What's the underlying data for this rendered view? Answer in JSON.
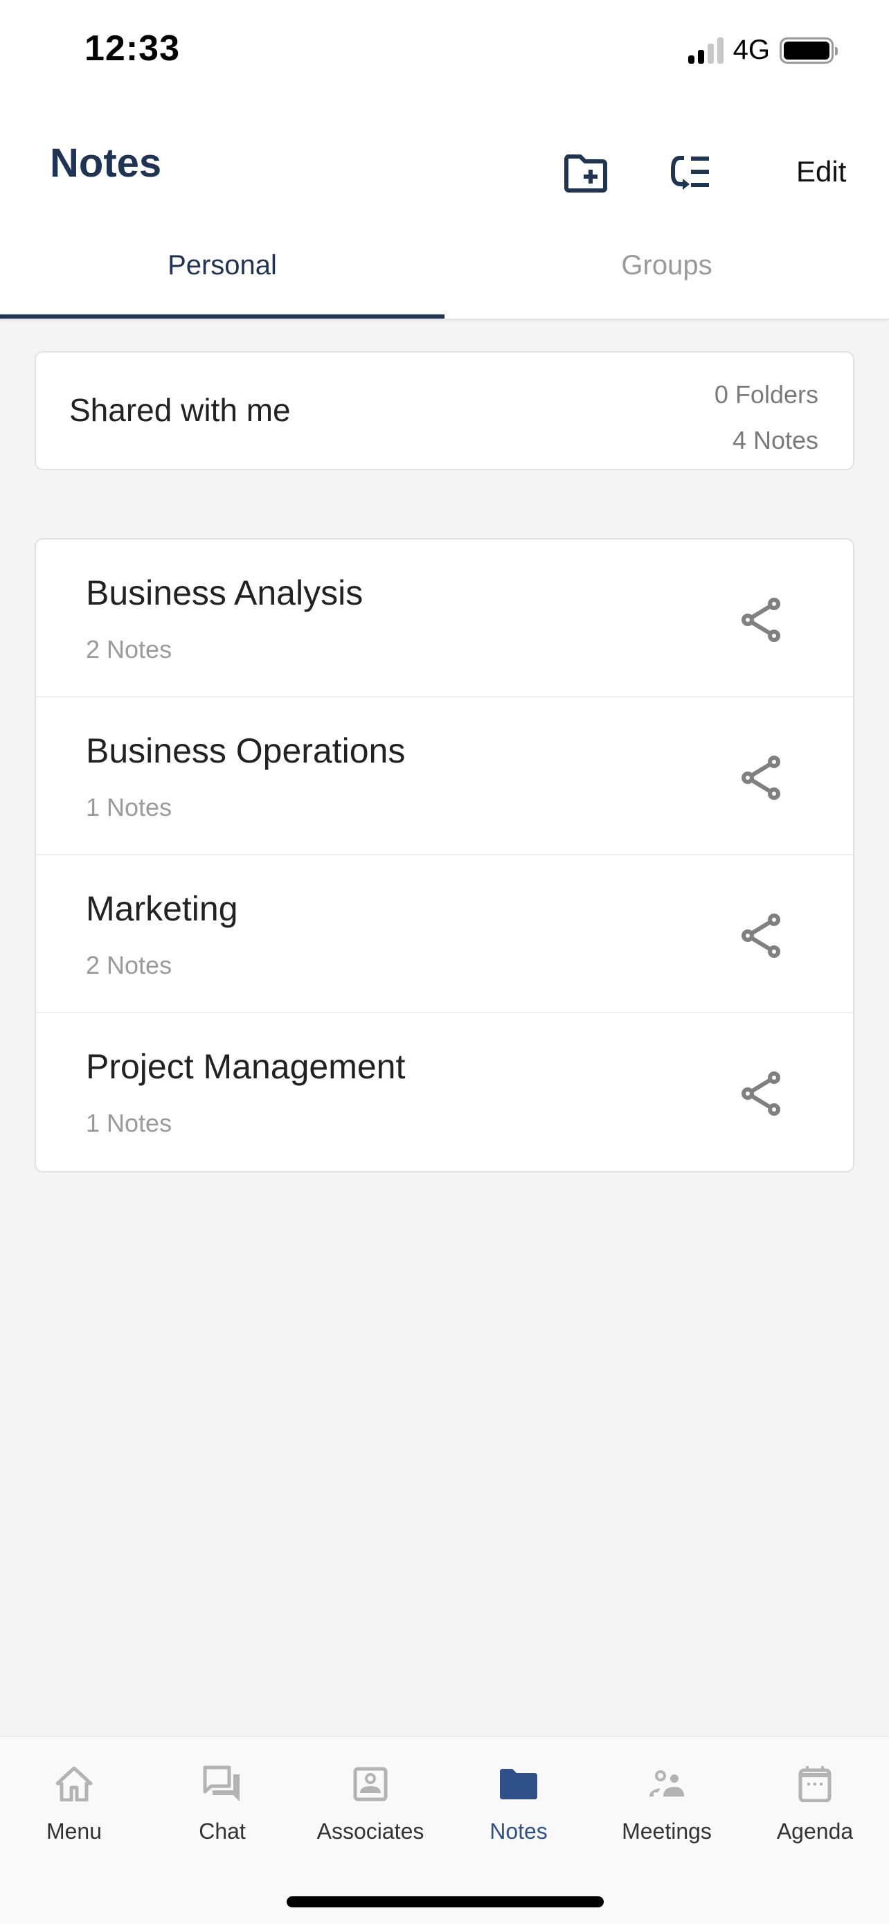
{
  "status_bar": {
    "time": "12:33",
    "network": "4G",
    "signal_bars_on": 2,
    "signal_bars_total": 4,
    "battery_level": 1.0
  },
  "header": {
    "title": "Notes",
    "actions": [
      {
        "icon": "new-folder-icon",
        "label": "New folder"
      },
      {
        "icon": "reorder-icon",
        "label": "Reorder"
      }
    ],
    "edit_label": "Edit"
  },
  "tabs": [
    {
      "label": "Personal",
      "active": true
    },
    {
      "label": "Groups",
      "active": false
    }
  ],
  "shared_with_me": {
    "title": "Shared with me",
    "folders_count": "0 Folders",
    "notes_count": "4 Notes"
  },
  "folders": [
    {
      "name": "Business Analysis",
      "count": "2 Notes",
      "icon": "share-icon"
    },
    {
      "name": "Business Operations",
      "count": "1 Notes",
      "icon": "share-icon"
    },
    {
      "name": "Marketing",
      "count": "2 Notes",
      "icon": "share-icon"
    },
    {
      "name": "Project Management",
      "count": "1 Notes",
      "icon": "share-icon"
    }
  ],
  "bottom_nav": [
    {
      "label": "Menu",
      "icon": "home-icon",
      "active": false
    },
    {
      "label": "Chat",
      "icon": "chat-icon",
      "active": false
    },
    {
      "label": "Associates",
      "icon": "contact-card-icon",
      "active": false
    },
    {
      "label": "Notes",
      "icon": "folder-icon",
      "active": true
    },
    {
      "label": "Meetings",
      "icon": "people-icon",
      "active": false
    },
    {
      "label": "Agenda",
      "icon": "calendar-icon",
      "active": false
    }
  ],
  "colors": {
    "primary": "#1f3454",
    "nav_active": "#2f5089",
    "inactive": "#9a9a9a",
    "icon_gray": "#b3b3b3",
    "share_icon": "#808080",
    "background": "#f4f4f4"
  }
}
